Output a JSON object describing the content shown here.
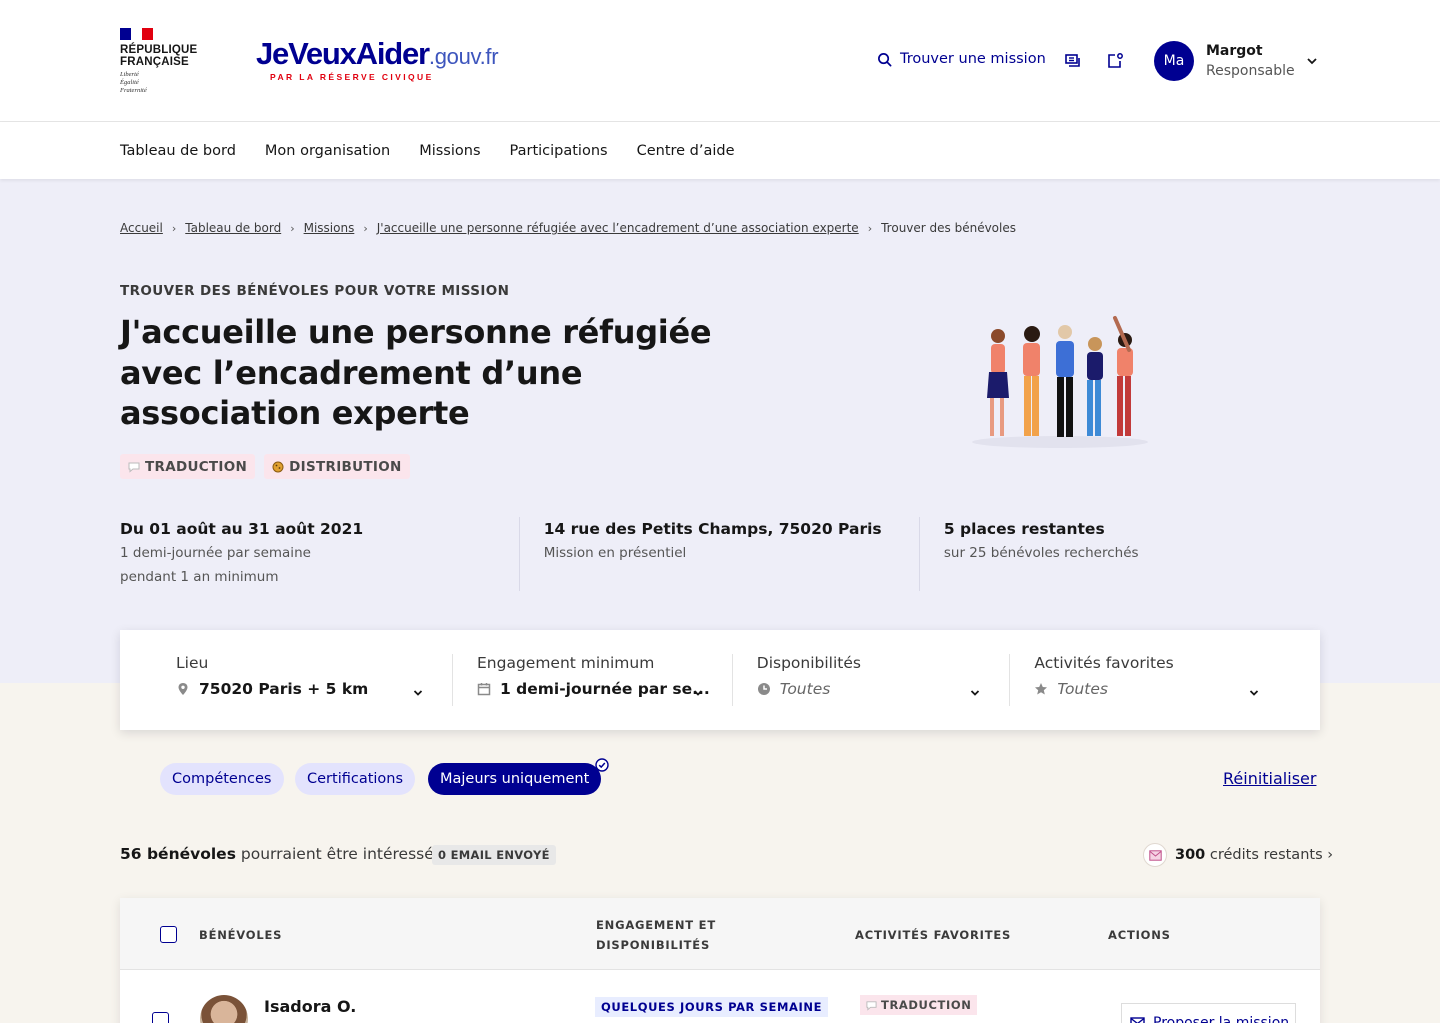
{
  "header": {
    "republic_line1": "République",
    "republic_line2": "Française",
    "motto": [
      "Liberté",
      "Égalité",
      "Fraternité"
    ],
    "brand_main": "JeVeuxAider",
    "brand_suffix": ".gouv.fr",
    "brand_sub": "PAR LA RÉSERVE CIVIQUE",
    "find_mission": "Trouver une mission",
    "avatar_initials": "Ma",
    "user_name": "Margot",
    "user_role": "Responsable"
  },
  "nav": [
    "Tableau de bord",
    "Mon organisation",
    "Missions",
    "Participations",
    "Centre d’aide"
  ],
  "breadcrumb": {
    "links": [
      "Accueil",
      "Tableau de bord",
      "Missions",
      "J'accueille une personne réfugiée avec l’encadrement d’une association experte"
    ],
    "current": "Trouver des bénévoles"
  },
  "mission": {
    "eyebrow": "TROUVER DES BÉNÉVOLES POUR VOTRE MISSION",
    "title": "J'accueille une personne réfugiée avec l’encadrement d’une association experte",
    "tags": [
      "TRADUCTION",
      "DISTRIBUTION"
    ]
  },
  "facts": [
    {
      "title": "Du 01 août au 31 août 2021",
      "sub": "1 demi-journée par semaine pendant 1 an minimum"
    },
    {
      "title": "14 rue des Petits Champs, 75020 Paris",
      "sub": "Mission en présentiel"
    },
    {
      "title": "5 places restantes",
      "sub": "sur 25 bénévoles recherchés"
    }
  ],
  "filters": [
    {
      "label": "Lieu",
      "value": "75020 Paris + 5 km",
      "icon": "map-pin-icon"
    },
    {
      "label": "Engagement minimum",
      "value": "1 demi-journée par se...",
      "icon": "calendar-icon"
    },
    {
      "label": "Disponibilités",
      "value": "Toutes",
      "icon": "clock-icon"
    },
    {
      "label": "Activités favorites",
      "value": "Toutes",
      "icon": "star-icon"
    }
  ],
  "pills": [
    "Compétences",
    "Certifications",
    "Majeurs uniquement"
  ],
  "reset": "Réinitialiser",
  "results": {
    "count": "56 bénévoles",
    "count_rest": "pourraient être intéressés",
    "email_badge": "0 EMAIL ENVOYÉ",
    "credits": "300",
    "credits_rest": "crédits restants ›"
  },
  "table": {
    "headers": [
      "BÉNÉVOLES",
      "ENGAGEMENT ET DISPONIBILITÉS",
      "ACTIVITÉS FAVORITES",
      "ACTIONS"
    ],
    "rows": [
      {
        "name": "Isadora O.",
        "engagement": "QUELQUES JOURS PAR SEMAINE",
        "activity": "TRADUCTION",
        "action": "Proposer la mission"
      }
    ]
  },
  "colors": {
    "primary": "#000091",
    "hero_bg": "#eeeef8",
    "page_bg": "#f7f4ee",
    "tag_bg": "#fbe5ec",
    "marianne_red": "#e1000f"
  }
}
